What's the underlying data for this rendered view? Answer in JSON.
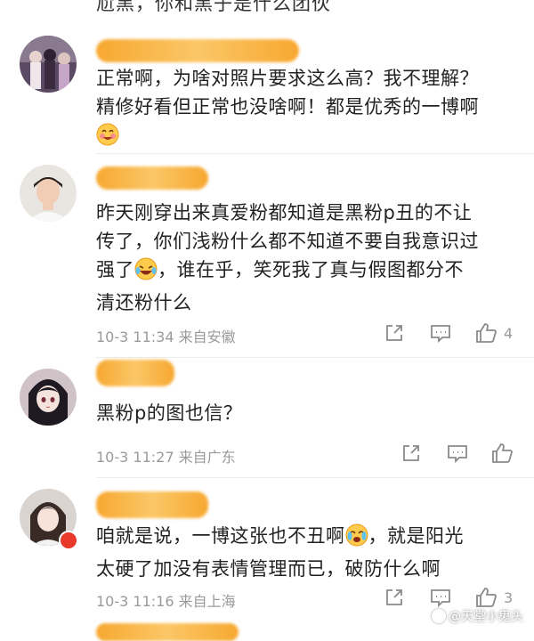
{
  "top_fragment": "尬黑，你和黑子是什么团伙",
  "comments": [
    {
      "lines": [
        "正常啊，为啥对照片要求这么高？我不理解？",
        "精修好看但正常也没啥啊！都是优秀的一博啊"
      ],
      "meta": "",
      "likes": "",
      "avatar_icon": "group-photo-avatar"
    },
    {
      "lines": [
        "昨天刚穿出来真爱粉都知道是黑粉p丑的不让",
        "传了，你们浅粉什么都不知道不要自我意识过",
        "强了",
        "，谁在乎，笑死我了真与假图都分不",
        "清还粉什么"
      ],
      "meta": "10-3 11:34 来自安徽",
      "likes": "4",
      "avatar_icon": "young-man-avatar"
    },
    {
      "lines": [
        "黑粉p的图也信？"
      ],
      "meta": "10-3 11:27 来自广东",
      "likes": "",
      "avatar_icon": "anime-girl-avatar"
    },
    {
      "lines": [
        "咱就是说，一博这张也不丑啊",
        "，就是阳光",
        "太硬了加没有表情管理而已，破防什么啊"
      ],
      "meta": "10-3 11:16 来自上海",
      "likes": "3",
      "avatar_icon": "girl-avatar"
    }
  ],
  "watermark": "@天堂小鬼头",
  "colors": {
    "name_redact": "#f7a830",
    "meta_gray": "#9a9a9a",
    "text": "#222222"
  }
}
